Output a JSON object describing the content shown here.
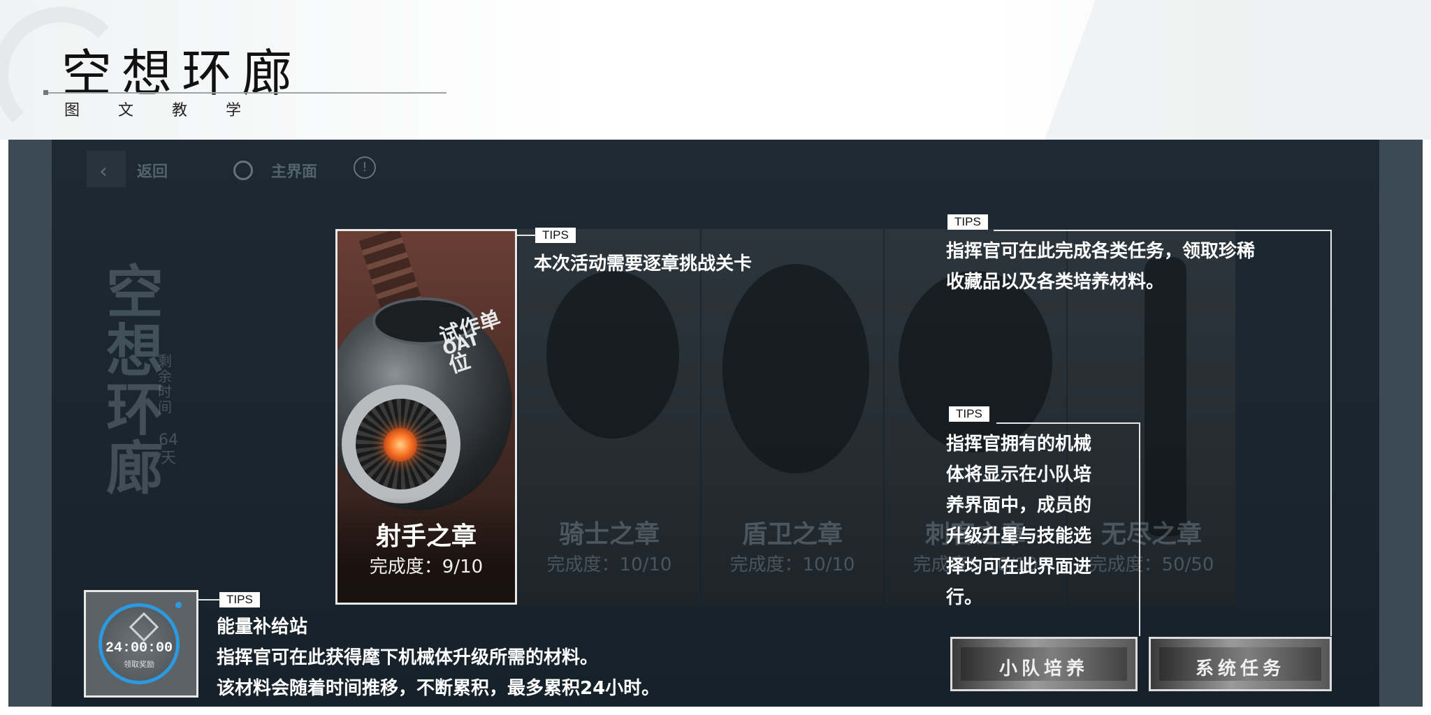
{
  "header": {
    "title": "空想环廊",
    "subtitle": "图 文 教 学"
  },
  "game": {
    "back_label": "返回",
    "home_label": "主界面",
    "info_glyph": "!",
    "side_title": "空想环廊",
    "remaining_label": "剩余时间",
    "remaining_days": "64天",
    "chapters": [
      {
        "name": "射手之章",
        "progress": "完成度：9/10",
        "active": true
      },
      {
        "name": "骑士之章",
        "progress": "完成度：10/10",
        "active": false
      },
      {
        "name": "盾卫之章",
        "progress": "完成度：10/10",
        "active": false
      },
      {
        "name": "刺客之章",
        "progress": "完成度：10/10",
        "active": false
      },
      {
        "name": "无尽之章",
        "progress": "完成度：50/50",
        "active": false
      }
    ],
    "active_card_label_1": "试作单位",
    "active_card_label_2": "OAT",
    "energy": {
      "time": "24:00:00",
      "sub": "领取奖励"
    },
    "buttons": {
      "squad": "小队培养",
      "tasks": "系统任务"
    }
  },
  "tips": {
    "tag": "TIPS",
    "chapter": "本次活动需要逐章挑战关卡",
    "tasks_1": "指挥官可在此完成各类任务，领取珍稀",
    "tasks_2": "收藏品以及各类培养材料。",
    "squad_lines": [
      "指挥官拥有的机械",
      "体将显示在小队培",
      "养界面中，成员的",
      "升级升星与技能选",
      "择均可在此界面进",
      "行。"
    ],
    "energy_title": "能量补给站",
    "energy_1": "指挥官可在此获得麾下机械体升级所需的材料。",
    "energy_2": "该材料会随着时间推移，不断累积，最多累积24小时。"
  },
  "colors": {
    "accent_blue": "#2c9ae0",
    "panel_bg": "#1a252d",
    "tip_white": "#ffffff"
  }
}
